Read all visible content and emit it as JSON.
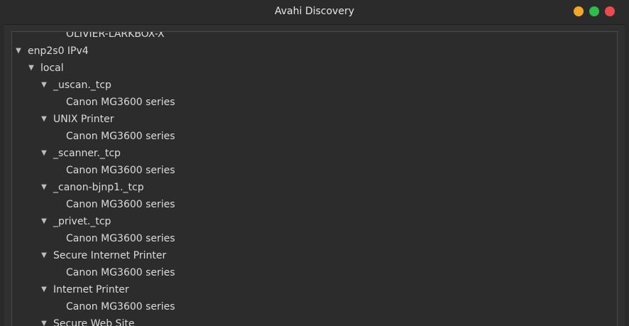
{
  "window": {
    "title": "Avahi Discovery",
    "buttons": {
      "minimize_color": "#f5a623",
      "maximize_color": "#2dbe4a",
      "close_color": "#ea4c4c"
    }
  },
  "tree": {
    "rows": [
      {
        "label": "OLIVIER-LARKBOX-X",
        "level": 3,
        "expandable": false
      },
      {
        "label": "enp2s0 IPv4",
        "level": 0,
        "expandable": true
      },
      {
        "label": "local",
        "level": 1,
        "expandable": true
      },
      {
        "label": "_uscan._tcp",
        "level": 2,
        "expandable": true
      },
      {
        "label": "Canon MG3600 series",
        "level": 3,
        "expandable": false
      },
      {
        "label": "UNIX Printer",
        "level": 2,
        "expandable": true
      },
      {
        "label": "Canon MG3600 series",
        "level": 3,
        "expandable": false
      },
      {
        "label": "_scanner._tcp",
        "level": 2,
        "expandable": true
      },
      {
        "label": "Canon MG3600 series",
        "level": 3,
        "expandable": false
      },
      {
        "label": "_canon-bjnp1._tcp",
        "level": 2,
        "expandable": true
      },
      {
        "label": "Canon MG3600 series",
        "level": 3,
        "expandable": false
      },
      {
        "label": "_privet._tcp",
        "level": 2,
        "expandable": true
      },
      {
        "label": "Canon MG3600 series",
        "level": 3,
        "expandable": false
      },
      {
        "label": "Secure Internet Printer",
        "level": 2,
        "expandable": true
      },
      {
        "label": "Canon MG3600 series",
        "level": 3,
        "expandable": false
      },
      {
        "label": "Internet Printer",
        "level": 2,
        "expandable": true
      },
      {
        "label": "Canon MG3600 series",
        "level": 3,
        "expandable": false
      },
      {
        "label": "Secure Web Site",
        "level": 2,
        "expandable": true
      }
    ]
  },
  "icons": {
    "expanded": "triangle-down-icon"
  }
}
